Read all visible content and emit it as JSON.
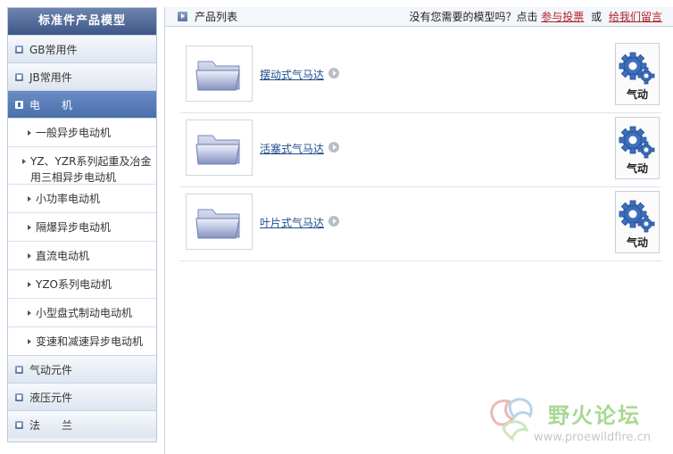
{
  "sidebar": {
    "title": "标准件产品模型",
    "categories_top": [
      {
        "label": "GB常用件"
      },
      {
        "label": "JB常用件"
      }
    ],
    "active_category": {
      "label": "电　　机"
    },
    "subitems": [
      {
        "label": "一般异步电动机"
      },
      {
        "label": "YZ、YZR系列起重及冶金用三相异步电动机"
      },
      {
        "label": "小功率电动机"
      },
      {
        "label": "隔爆异步电动机"
      },
      {
        "label": "直流电动机"
      },
      {
        "label": "YZO系列电动机"
      },
      {
        "label": "小型盘式制动电动机"
      },
      {
        "label": "变速和减速异步电动机"
      }
    ],
    "categories_bottom": [
      {
        "label": "气动元件"
      },
      {
        "label": "液压元件"
      },
      {
        "label": "法　　兰"
      }
    ]
  },
  "header": {
    "list_title": "产品列表",
    "prompt_text": "没有您需要的模型吗？点击",
    "vote_link": "参与投票",
    "or_text": "或",
    "message_link": "给我们留言"
  },
  "products": [
    {
      "name": "摆动式气马达",
      "category_label": "气动"
    },
    {
      "name": "活塞式气马达",
      "category_label": "气动"
    },
    {
      "name": "叶片式气马达",
      "category_label": "气动"
    }
  ],
  "watermark": {
    "title": "野火论坛",
    "url": "www.proewildfire.cn"
  },
  "colors": {
    "sidebar_header": "#3d5788",
    "active_category": "#4a6eab",
    "link_red": "#b0242a",
    "link_blue": "#1f4e8c",
    "gear_blue": "#3d6fbe"
  }
}
